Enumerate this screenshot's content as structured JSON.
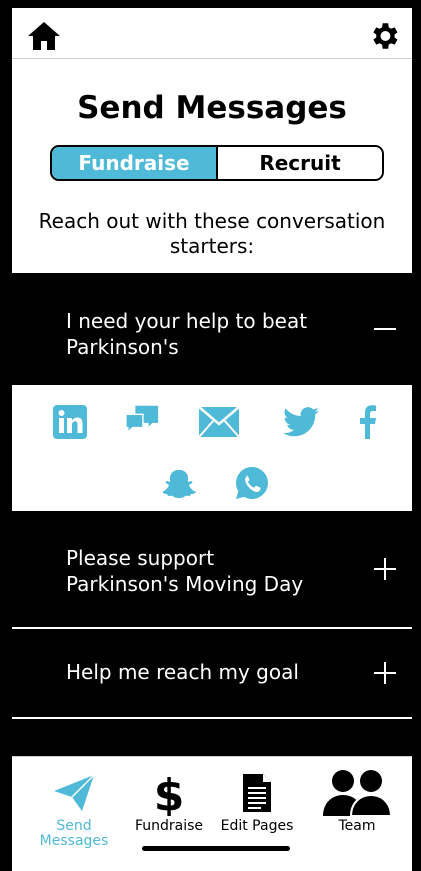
{
  "header": {
    "home_icon": "home-icon",
    "settings_icon": "gear-icon"
  },
  "page": {
    "title": "Send Messages"
  },
  "segment": {
    "tabs": [
      {
        "label": "Fundraise",
        "active": true
      },
      {
        "label": "Recruit",
        "active": false
      }
    ]
  },
  "intro_text": "Reach out with these conversation starters:",
  "accent_color": "#4fb9d8",
  "messages": [
    {
      "line1": "I need your help to beat",
      "line2": "Parkinson's",
      "expanded": true
    },
    {
      "line1": "Please support",
      "line2": "Parkinson's Moving Day",
      "expanded": false
    },
    {
      "line1": "Help me reach my goal",
      "line2": "",
      "expanded": false
    }
  ],
  "share_icons": [
    "linkedin-icon",
    "chat-icon",
    "email-icon",
    "twitter-icon",
    "facebook-icon",
    "snapchat-icon",
    "whatsapp-icon"
  ],
  "bottom_nav": [
    {
      "label": "Send Messages",
      "icon": "paper-plane-icon",
      "active": true
    },
    {
      "label": "Fundraise",
      "icon": "dollar-icon",
      "active": false
    },
    {
      "label": "Edit Pages",
      "icon": "document-icon",
      "active": false
    },
    {
      "label": "Team",
      "icon": "team-icon",
      "active": false
    }
  ]
}
